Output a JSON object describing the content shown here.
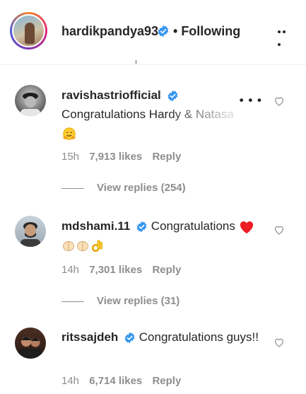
{
  "header": {
    "username": "hardikpandya93",
    "follow_state": "Following",
    "icons": {
      "verified": "verified-badge-icon",
      "more": "more-options-icon"
    }
  },
  "colors": {
    "verified": "#3897f0",
    "text": "#262626",
    "muted": "#8e8e8e",
    "heart_red": "#ed1c24"
  },
  "comments": [
    {
      "username": "ravishastriofficial",
      "text": "Congratulations Hardy & Natasa",
      "emoji": "hugging-face-emoji",
      "time": "15h",
      "likes": "7,913 likes",
      "reply": "Reply",
      "view_replies": "View replies (254)"
    },
    {
      "username": "mdshami.11",
      "text": "Congratulations",
      "emoji": "red-heart, folded-hands, folded-hands, ok-hand",
      "time": "14h",
      "likes": "7,301 likes",
      "reply": "Reply",
      "view_replies": "View replies (31)"
    },
    {
      "username": "ritssajdeh",
      "text": "Congratulations guys!!",
      "emoji": "",
      "time": "14h",
      "likes": "6,714 likes",
      "reply": "Reply"
    }
  ]
}
